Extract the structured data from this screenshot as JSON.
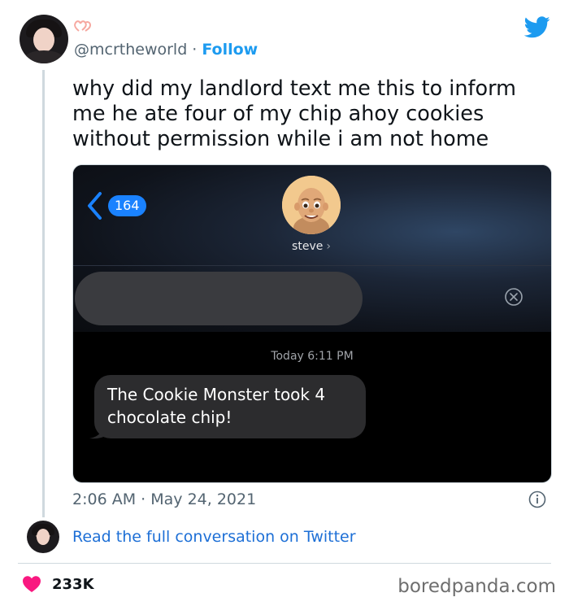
{
  "tweet": {
    "handle": "@mcrtheworld",
    "separator": "·",
    "follow_label": "Follow",
    "text": "why did my landlord text me this to inform me he ate four of my chip ahoy cookies without permission while i am not home",
    "time": "2:06 AM",
    "date": "May 24, 2021",
    "read_more": "Read the full conversation on Twitter",
    "likes": "233K"
  },
  "screenshot": {
    "unread_count": "164",
    "contact_name": "steve",
    "contact_chevron": "›",
    "timestamp": "Today 6:11 PM",
    "message": "The Cookie Monster took 4 chocolate chip!"
  },
  "watermark": "boredpanda.com",
  "colors": {
    "twitter_blue": "#1d9bf0",
    "imessage_blue": "#1a82ff",
    "like_pink": "#f91880",
    "bubble_gray": "#2c2c2e"
  },
  "icons": [
    "hearts-icon",
    "twitter-bird-icon",
    "back-chevron-icon",
    "memoji-avatar",
    "clear-icon",
    "info-icon",
    "heart-icon"
  ]
}
